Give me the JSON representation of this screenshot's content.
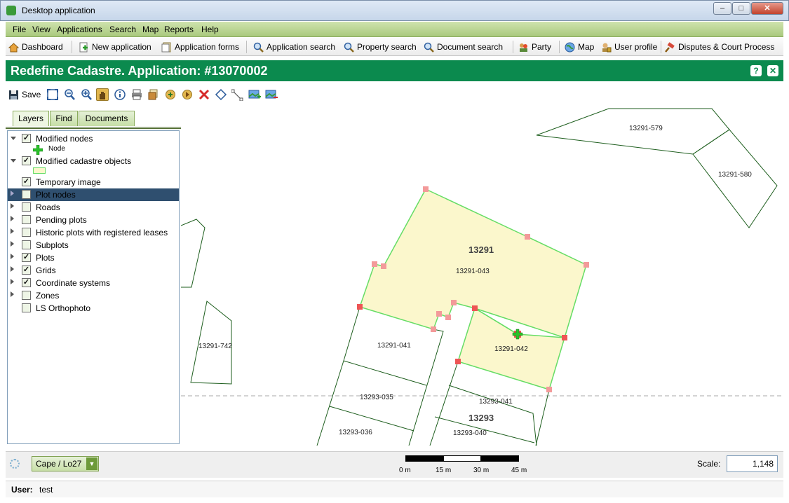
{
  "window": {
    "title": "Desktop application",
    "minimize": "–",
    "maximize": "□",
    "close": "✕"
  },
  "menu": [
    "File",
    "View",
    "Applications",
    "Search",
    "Map",
    "Reports",
    "Help"
  ],
  "nav": {
    "dashboard": "Dashboard",
    "new_application": "New application",
    "application_forms": "Application forms",
    "application_search": "Application search",
    "property_search": "Property search",
    "document_search": "Document search",
    "party": "Party",
    "map": "Map",
    "user_profile": "User profile",
    "disputes": "Disputes & Court Process"
  },
  "page": {
    "title": "Redefine Cadastre. Application: #13070002",
    "help": "?",
    "close": "✕"
  },
  "toolbar": {
    "save": "Save",
    "tools": [
      "full-extent-icon",
      "zoom-out-icon",
      "zoom-in-icon",
      "pan-icon",
      "info-icon",
      "print-icon",
      "layers-icon",
      "add-point-icon",
      "edit-point-icon",
      "delete-icon",
      "select-polygon-icon",
      "line-icon",
      "add-image-icon",
      "remove-image-icon"
    ]
  },
  "tabs": {
    "layers": "Layers",
    "find": "Find",
    "documents": "Documents"
  },
  "layers": [
    {
      "label": "Modified nodes",
      "checked": true,
      "expander": "down",
      "legend": "Node"
    },
    {
      "label": "Modified cadastre objects",
      "checked": true,
      "expander": "down"
    },
    {
      "label": "Temporary image",
      "checked": true,
      "expander": "none"
    },
    {
      "label": "Plot nodes",
      "checked": false,
      "expander": "right",
      "selected": true
    },
    {
      "label": "Roads",
      "checked": false,
      "expander": "right"
    },
    {
      "label": "Pending plots",
      "checked": false,
      "expander": "right"
    },
    {
      "label": "Historic plots with registered leases",
      "checked": false,
      "expander": "right"
    },
    {
      "label": "Subplots",
      "checked": false,
      "expander": "right"
    },
    {
      "label": "Plots",
      "checked": true,
      "expander": "right"
    },
    {
      "label": "Grids",
      "checked": true,
      "expander": "right"
    },
    {
      "label": "Coordinate systems",
      "checked": true,
      "expander": "right"
    },
    {
      "label": "Zones",
      "checked": false,
      "expander": "right"
    },
    {
      "label": "LS Orthophoto",
      "checked": false,
      "expander": "none"
    }
  ],
  "map": {
    "labels": {
      "p579": "13291-579",
      "p580": "13291-580",
      "p742": "13291-742",
      "block13291": "13291",
      "p043": "13291-043",
      "p041": "13291-041",
      "p042": "13291-042",
      "p035": "13293-035",
      "p041b": "13293-041",
      "block13293": "13293",
      "p036": "13293-036",
      "p040": "13293-040"
    },
    "colors": {
      "plot_line": "#1e5e1e",
      "fill": "#fbf7cc",
      "edit_line": "#66dd66",
      "node": "#ee5555"
    }
  },
  "status": {
    "crs": "Cape / Lo27",
    "scale_label": "Scale:",
    "scale_value": "1,148",
    "scalebar": [
      "0 m",
      "15 m",
      "30 m",
      "45 m"
    ]
  },
  "user": {
    "label": "User:",
    "name": "test"
  }
}
